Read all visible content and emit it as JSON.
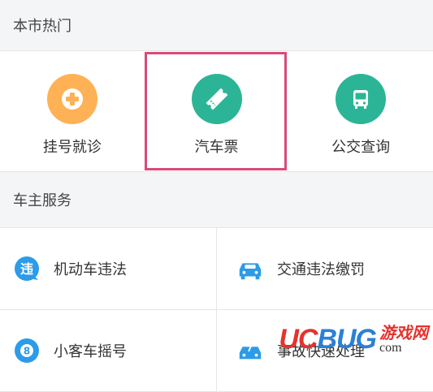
{
  "sections": {
    "hot": {
      "title": "本市热门"
    },
    "car": {
      "title": "车主服务"
    }
  },
  "hot_items": [
    {
      "label": "挂号就诊",
      "icon": "medical-cross-icon",
      "color": "#ffb155"
    },
    {
      "label": "汽车票",
      "icon": "ticket-icon",
      "color": "#2bb596"
    },
    {
      "label": "公交查询",
      "icon": "bus-icon",
      "color": "#2bb596"
    }
  ],
  "highlight_color": "#d94a7a",
  "services": [
    {
      "label": "机动车违法",
      "icon": "violation-icon",
      "color": "#2c9be8"
    },
    {
      "label": "交通违法缴罚",
      "icon": "car-icon",
      "color": "#2c9be8"
    },
    {
      "label": "小客车摇号",
      "icon": "lottery-icon",
      "color": "#2c9be8"
    },
    {
      "label": "事故快速处理",
      "icon": "accident-icon",
      "color": "#2c9be8"
    }
  ],
  "watermark": {
    "uc": "UC",
    "bug": "BUG",
    "cn": "游戏网",
    "com": "com"
  }
}
